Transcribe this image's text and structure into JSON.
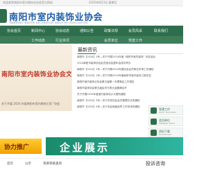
{
  "topbar": {
    "left_text": "欢迎来到南阳市室内装饰业协会官方网站",
    "date_text": "2025年8月3日 星期日"
  },
  "header": {
    "title": "南阳市室内装饰业协会",
    "subtitle": "NANYANG INDOOR DECORATION INDUSTRY ASSOCIATION"
  },
  "nav": {
    "row1": [
      "协会首页",
      "新闻中心",
      "协会动态",
      "通知公告",
      "政策法规",
      "会员风采",
      "联系我们"
    ],
    "row2": [
      "工作动态",
      "行业资讯",
      "会员单位",
      "党建工作"
    ]
  },
  "banner": {
    "text": "南阳市室内装饰业协会文件",
    "caption": "关于开展 2024 年度南阳市室内装饰工程 “协会"
  },
  "news": {
    "title": "最新资讯",
    "items": [
      "南阳市【2024】1号—关于开展2024年度 “南阳市室内装饰” 评选活动",
      "2024南阳市装饰协会会员座谈会暨年会成功举办",
      "南阳市【2024】2号—关于开展2024年度协会会员单位年审工作通知",
      "南阳市【2024】1号—关于开展2024年度南阳市室内装饰工程评定",
      "南阳市室内装饰业协会第五届第一次理事会工作报告",
      "南阳市装饰协会第五届会员代表大会圆满召开",
      "关于开展2024年度室内装饰设计大赛的通知",
      "南阳市【2024】3号—关于印发协会会员管理办法的通知",
      "南阳市【2024】4号—关于协会换届选举工作安排的通知"
    ]
  },
  "side": {
    "cards": [
      {
        "label": "党建工作",
        "sub": "PARTY BUILDING"
      },
      {
        "label": "会员单位",
        "sub": "MEMBER UNITS"
      },
      {
        "label": "资料下载",
        "sub": "DOWNLOAD"
      }
    ]
  },
  "ads": {
    "left": "协力推广",
    "right": "企业展示"
  },
  "footer": {
    "items": [
      "首页",
      "公示",
      "资质等级查询"
    ],
    "side_title": "投诉咨询"
  }
}
